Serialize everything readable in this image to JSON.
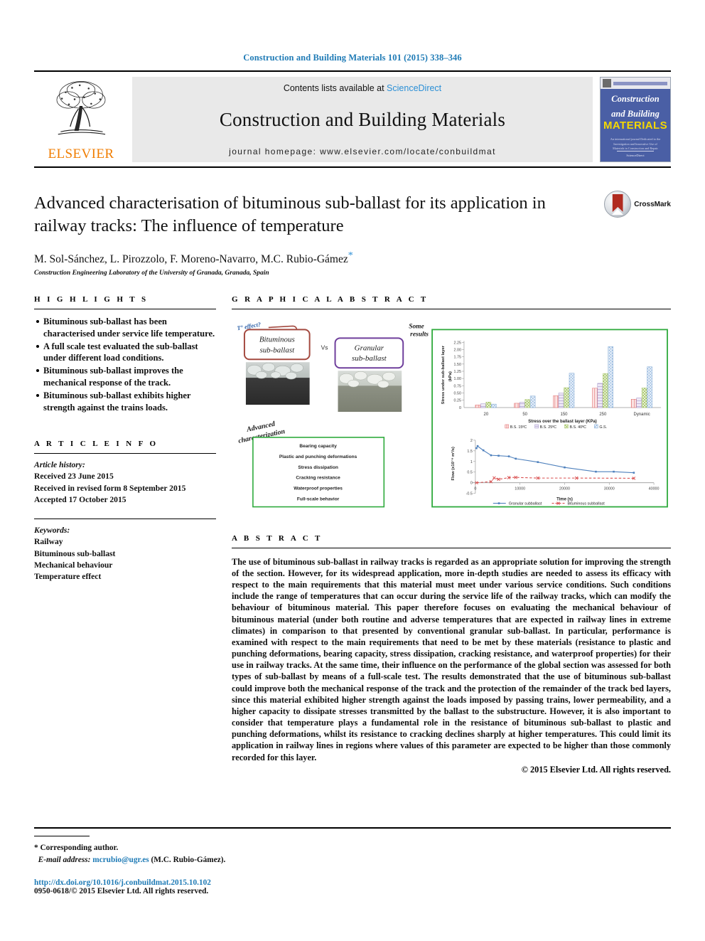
{
  "running_head": "Construction and Building Materials 101 (2015) 338–346",
  "masthead": {
    "contents_prefix": "Contents lists available at",
    "sciencedirect": "ScienceDirect",
    "journal_title": "Construction and Building Materials",
    "homepage": "journal homepage: www.elsevier.com/locate/conbuildmat",
    "publisher": "ELSEVIER",
    "cover": {
      "line1": "Construction",
      "line2": "and Building",
      "line3": "MATERIALS",
      "blurb": "An international journal Dedicated to the Investigation and Innovative Use of Materials in Construction and Repair",
      "foot": "ScienceDirect"
    }
  },
  "article": {
    "title": "Advanced characterisation of bituminous sub-ballast for its application in railway tracks: The influence of temperature",
    "authors": "M. Sol-Sánchez, L. Pirozzolo, F. Moreno-Navarro, M.C. Rubio-Gámez",
    "corresponding_marker": "*",
    "affiliation": "Construction Engineering Laboratory of the University of Granada, Granada, Spain",
    "crossmark_label": "CrossMark"
  },
  "highlights": {
    "heading": "H I G H L I G H T S",
    "items": [
      "Bituminous sub-ballast has been characterised under service life temperature.",
      "A full scale test evaluated the sub-ballast under different load conditions.",
      "Bituminous sub-ballast improves the mechanical response of the track.",
      "Bituminous sub-ballast exhibits higher strength against the trains loads."
    ]
  },
  "graphical_abstract": {
    "heading": "G R A P H I C A L   A B S T R A C T",
    "temperature_effect_label": "T° effect?",
    "box_bituminous": "Bituminous sub-ballast",
    "box_granular": "Granular sub-ballast",
    "vs": "Vs",
    "some_results": "Some results",
    "advanced_characterization": "Advanced characterization",
    "characterization_items": [
      "Bearing capacity",
      "Plastic and punching deformations",
      "Stress dissipation",
      "Cracking resistance",
      "Waterproof properties",
      "Full-scale behavior"
    ]
  },
  "chart_data": [
    {
      "type": "bar",
      "title": "",
      "xlabel": "Stress over the ballast layer (KPa)",
      "ylabel": "Stress under sub-ballast layer (kPa)",
      "categories": [
        "20",
        "50",
        "150",
        "250",
        "Dynamic"
      ],
      "ylim": [
        0,
        225
      ],
      "yticks": [
        0,
        25,
        50,
        75,
        100,
        125,
        150,
        175,
        200,
        225
      ],
      "grid": false,
      "legend_position": "bottom",
      "series": [
        {
          "name": "B.S. 15ºC",
          "color": "#e06666",
          "values": [
            9,
            15,
            41,
            67,
            29
          ]
        },
        {
          "name": "B.S. 25ºC",
          "color": "#9a8cc4",
          "values": [
            13,
            18,
            50,
            84,
            33
          ]
        },
        {
          "name": "B.S. 40ºC",
          "color": "#a8c66c",
          "values": [
            19,
            28,
            69,
            118,
            68
          ]
        },
        {
          "name": "G.S.",
          "color": "#7fa8d4",
          "values": [
            12,
            40,
            119,
            211,
            141
          ]
        }
      ]
    },
    {
      "type": "line",
      "title": "",
      "xlabel": "Time (s)",
      "ylabel": "Flow (x10⁻⁸ m³/s)",
      "xlim": [
        0,
        40000
      ],
      "ylim": [
        -0.5,
        2
      ],
      "xticks": [
        0,
        10000,
        20000,
        30000,
        40000
      ],
      "yticks": [
        -0.5,
        0,
        0.5,
        1,
        1.5,
        2
      ],
      "grid": false,
      "legend_position": "bottom",
      "series": [
        {
          "name": "Granular subballast",
          "color": "#4f81bd",
          "x": [
            250,
            500,
            1800,
            3500,
            5200,
            7500,
            9200,
            14000,
            20000,
            27000,
            31000,
            35500
          ],
          "y": [
            1.62,
            1.72,
            1.52,
            1.29,
            1.27,
            1.24,
            1.13,
            0.97,
            0.72,
            0.52,
            0.52,
            0.47
          ]
        },
        {
          "name": "Bituminous subballast",
          "color": "#d94f4f",
          "x": [
            250,
            3500,
            4200,
            5200,
            7500,
            9200,
            14000,
            22500,
            35500
          ],
          "y": [
            0.0,
            0.05,
            0.23,
            0.16,
            0.24,
            0.25,
            0.22,
            0.22,
            0.21
          ]
        }
      ]
    }
  ],
  "article_info": {
    "heading": "A R T I C L E   I N F O",
    "history_label": "Article history:",
    "history": [
      "Received 23 June 2015",
      "Received in revised form 8 September 2015",
      "Accepted 17 October 2015"
    ],
    "keywords_label": "Keywords:",
    "keywords": [
      "Railway",
      "Bituminous sub-ballast",
      "Mechanical behaviour",
      "Temperature effect"
    ]
  },
  "abstract": {
    "heading": "A B S T R A C T",
    "text": "The use of bituminous sub-ballast in railway tracks is regarded as an appropriate solution for improving the strength of the section. However, for its widespread application, more in-depth studies are needed to assess its efficacy with respect to the main requirements that this material must meet under various service conditions. Such conditions include the range of temperatures that can occur during the service life of the railway tracks, which can modify the behaviour of bituminous material. This paper therefore focuses on evaluating the mechanical behaviour of bituminous material (under both routine and adverse temperatures that are expected in railway lines in extreme climates) in comparison to that presented by conventional granular sub-ballast. In particular, performance is examined with respect to the main requirements that need to be met by these materials (resistance to plastic and punching deformations, bearing capacity, stress dissipation, cracking resistance, and waterproof properties) for their use in railway tracks. At the same time, their influence on the performance of the global section was assessed for both types of sub-ballast by means of a full-scale test. The results demonstrated that the use of bituminous sub-ballast could improve both the mechanical response of the track and the protection of the remainder of the track bed layers, since this material exhibited higher strength against the loads imposed by passing trains, lower permeability, and a higher capacity to dissipate stresses transmitted by the ballast to the substructure. However, it is also important to consider that temperature plays a fundamental role in the resistance of bituminous sub-ballast to plastic and punching deformations, whilst its resistance to cracking declines sharply at higher temperatures. This could limit its application in railway lines in regions where values of this parameter are expected to be higher than those commonly recorded for this layer.",
    "copyright": "© 2015 Elsevier Ltd. All rights reserved."
  },
  "footer": {
    "corresponding": "* Corresponding author.",
    "email_label": "E-mail address:",
    "email": "mcrubio@ugr.es",
    "email_owner": "(M.C. Rubio-Gámez).",
    "doi": "http://dx.doi.org/10.1016/j.conbuildmat.2015.10.102",
    "issn": "0950-0618/© 2015 Elsevier Ltd. All rights reserved."
  }
}
